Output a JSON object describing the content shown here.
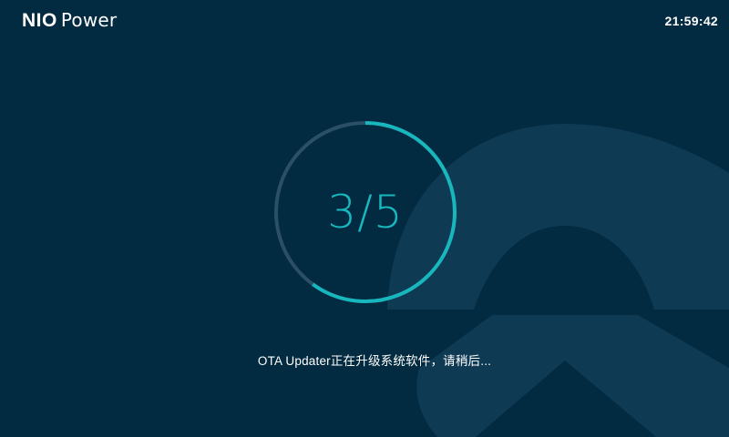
{
  "header": {
    "brand_bold": "NIO",
    "brand_light": "Power",
    "clock": "21:59:42"
  },
  "update": {
    "step_label": "3/5",
    "current_step": 3,
    "total_steps": 5,
    "progress_fraction": 0.6,
    "message": "OTA Updater正在升级系统软件，请稍后..."
  },
  "colors": {
    "background": "#022a40",
    "logo_watermark": "#0f3a54",
    "ring_track": "#2b4f66",
    "ring_progress": "#17b7bd",
    "text": "#ffffff"
  },
  "icons": {
    "watermark": "nio-logo-watermark"
  }
}
